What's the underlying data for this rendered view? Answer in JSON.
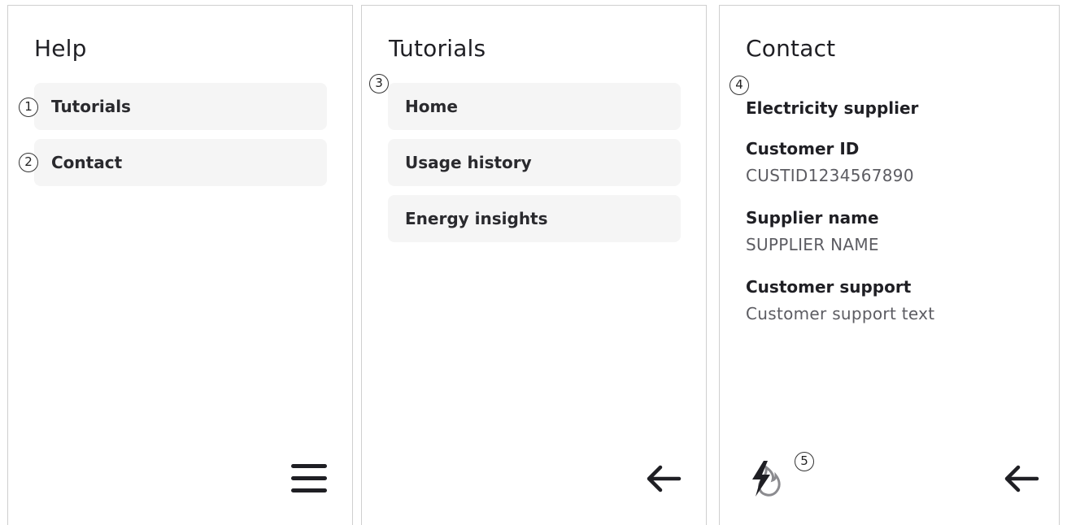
{
  "help": {
    "title": "Help",
    "items": [
      {
        "label": "Tutorials",
        "marker": "1"
      },
      {
        "label": "Contact",
        "marker": "2"
      }
    ],
    "menu_icon": "hamburger-menu-icon"
  },
  "tutorials": {
    "title": "Tutorials",
    "marker": "3",
    "items": [
      {
        "label": "Home"
      },
      {
        "label": "Usage history"
      },
      {
        "label": "Energy insights"
      }
    ],
    "back_icon": "arrow-left-icon"
  },
  "contact": {
    "title": "Contact",
    "marker": "4",
    "section_heading": "Electricity supplier",
    "fields": [
      {
        "label": "Customer ID",
        "value": "CUSTID1234567890"
      },
      {
        "label": "Supplier name",
        "value": "SUPPLIER NAME"
      },
      {
        "label": "Customer support",
        "value": "Customer support text"
      }
    ],
    "energy_icon_marker": "5",
    "energy_icon": "electricity-gas-icon",
    "back_icon": "arrow-left-icon"
  }
}
